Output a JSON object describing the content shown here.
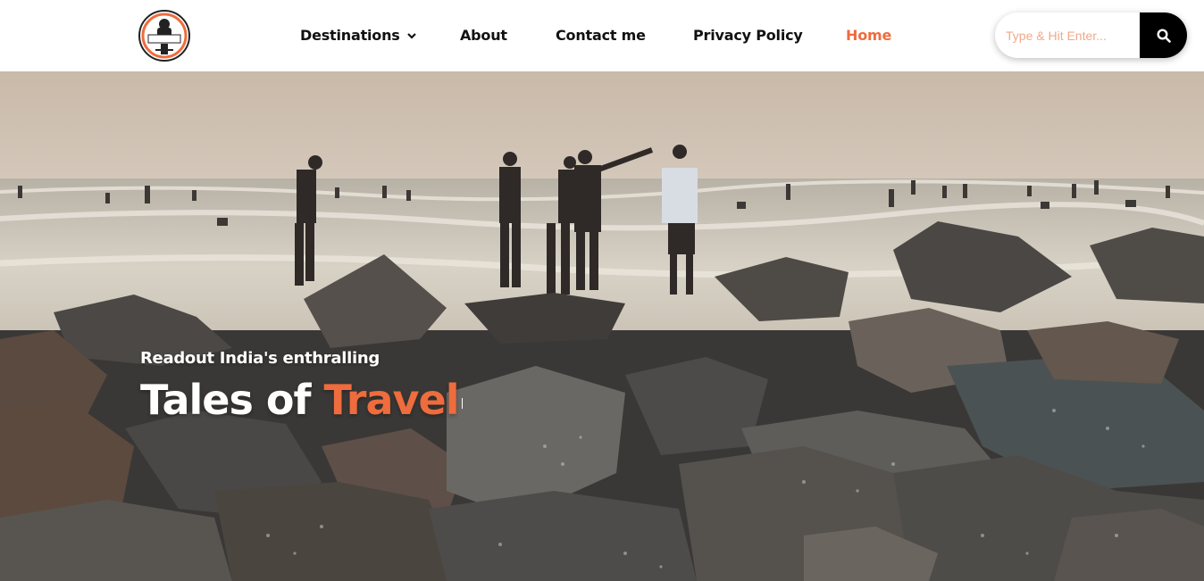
{
  "header": {
    "logo_text": "TALES OF TRAVEL",
    "nav": [
      {
        "label": "Destinations",
        "has_dropdown": true,
        "active": false
      },
      {
        "label": "About",
        "has_dropdown": false,
        "active": false
      },
      {
        "label": "Contact me",
        "has_dropdown": false,
        "active": false
      },
      {
        "label": "Privacy Policy",
        "has_dropdown": false,
        "active": false
      },
      {
        "label": "Home",
        "has_dropdown": false,
        "active": true
      }
    ],
    "search": {
      "placeholder": "Type & Hit Enter...",
      "value": "",
      "button_icon": "search-icon"
    }
  },
  "hero": {
    "subtitle": "Readout India's enthralling",
    "title_main": "Tales of ",
    "title_accent": "Travel"
  },
  "colors": {
    "accent": "#ee6c3d",
    "text": "#111111",
    "search_button": "#000000",
    "placeholder": "#f0a98a"
  }
}
